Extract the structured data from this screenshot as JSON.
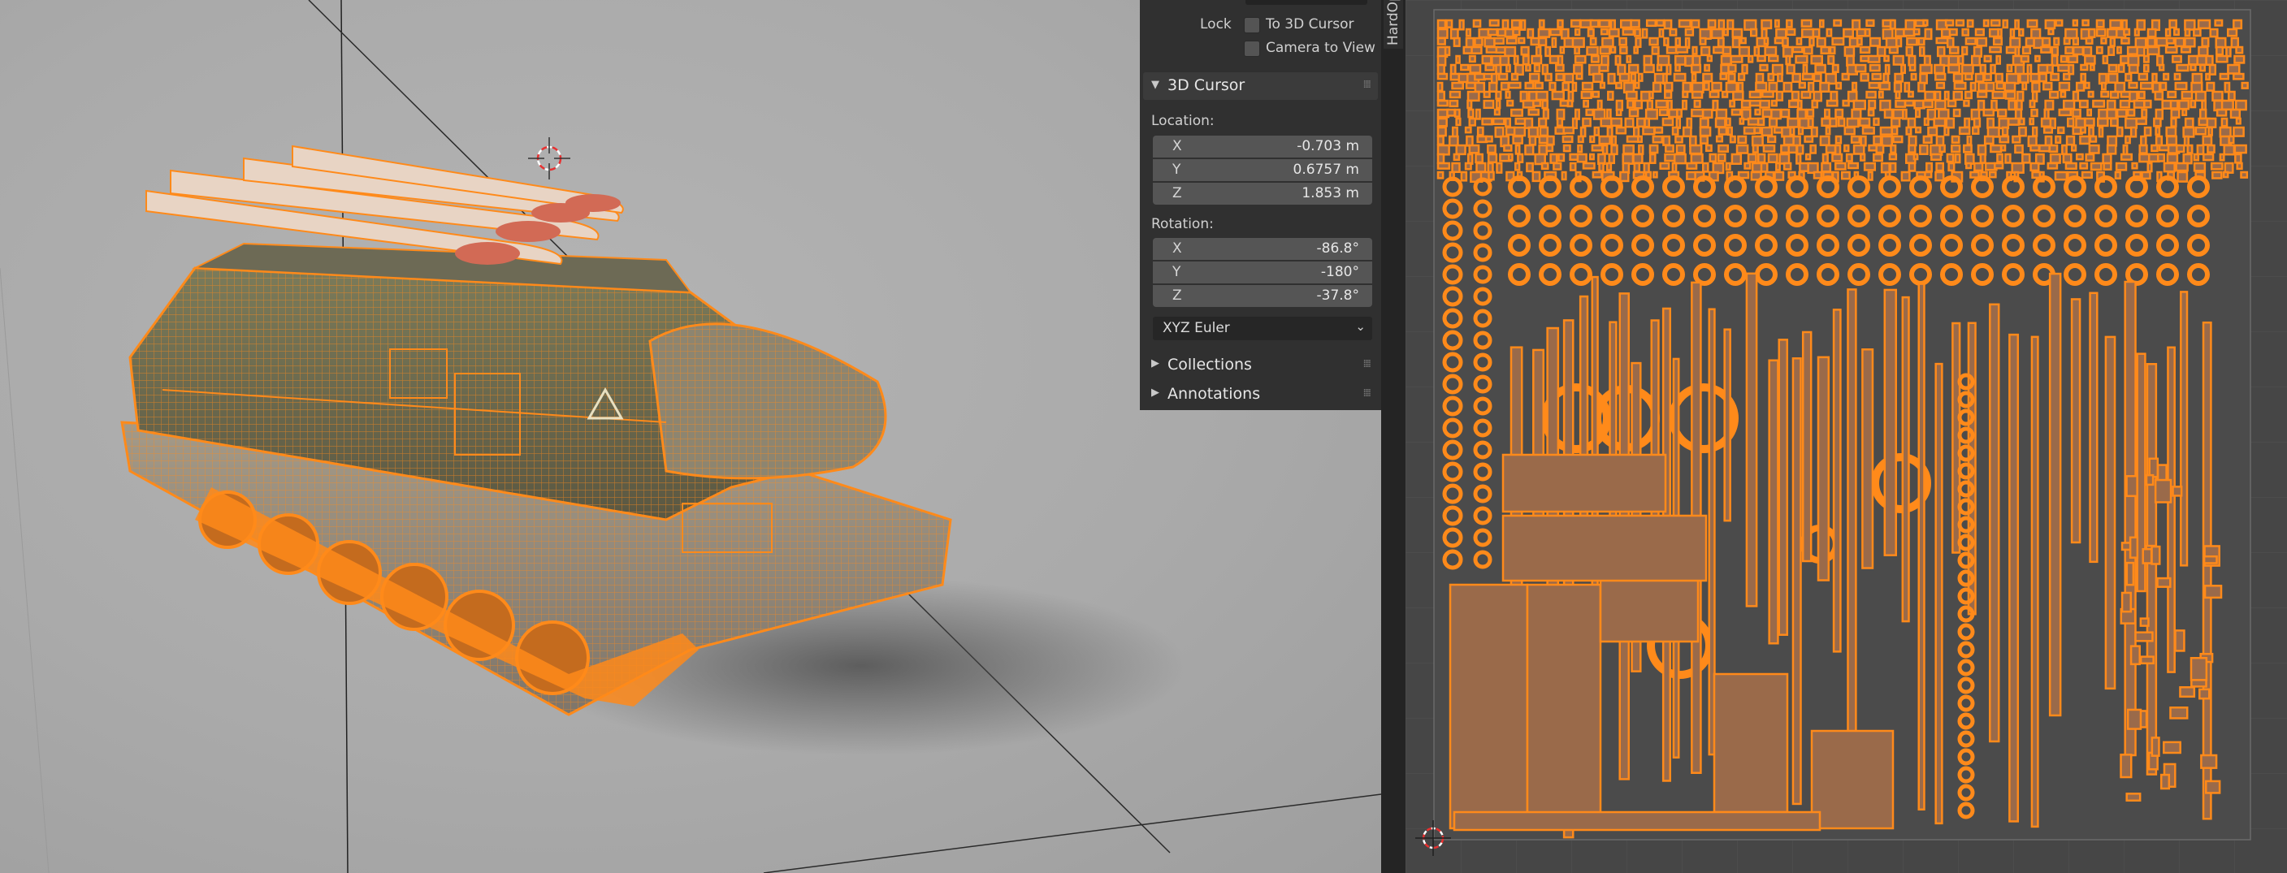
{
  "npanel": {
    "lock_label": "Lock",
    "to_3d_cursor": "To 3D Cursor",
    "camera_to_view": "Camera to View",
    "cursor_section": "3D Cursor",
    "location_label": "Location:",
    "location": [
      {
        "axis": "X",
        "value": "-0.703 m"
      },
      {
        "axis": "Y",
        "value": "0.6757 m"
      },
      {
        "axis": "Z",
        "value": "1.853 m"
      }
    ],
    "rotation_label": "Rotation:",
    "rotation": [
      {
        "axis": "X",
        "value": "-86.8°"
      },
      {
        "axis": "Y",
        "value": "-180°"
      },
      {
        "axis": "Z",
        "value": "-37.8°"
      }
    ],
    "rotation_mode": "XYZ Euler",
    "collections_section": "Collections",
    "annotations_section": "Annotations"
  },
  "sidebar_tab": {
    "label": "HardOps"
  },
  "colors": {
    "selection_orange": "#ff8a1a",
    "uv_fill": "#9a6a4a",
    "panel_bg": "#303030",
    "field_bg": "#555555",
    "viewport_bg": "#aaaaaa"
  },
  "icons": [
    "cursor-icon",
    "checkbox-icon",
    "disclosure-triangle-icon",
    "chevron-down-icon",
    "drag-grip-icon"
  ]
}
